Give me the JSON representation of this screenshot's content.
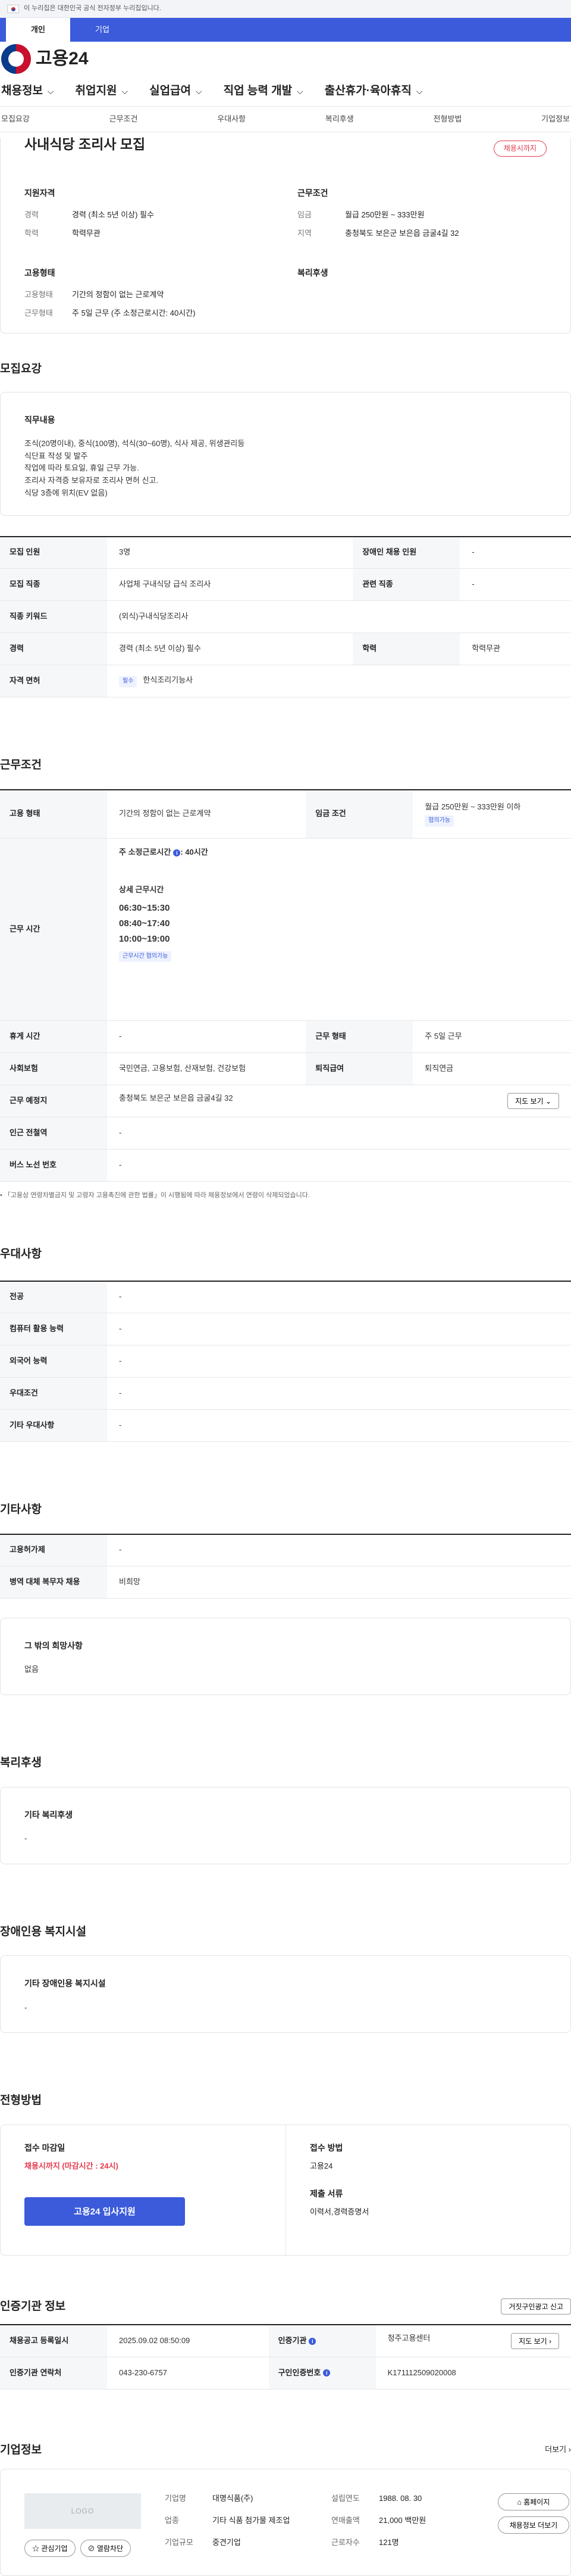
{
  "gov_banner": "이 누리집은 대한민국 공식 전자정부 누리집입니다.",
  "user_tabs": [
    "개인",
    "기업"
  ],
  "logo_text": "고용24",
  "gnb": [
    "채용정보",
    "취업지원",
    "실업급여",
    "직업 능력 개발",
    "출산휴가·육아휴직"
  ],
  "tabbar": [
    "모집요강",
    "근무조건",
    "우대사항",
    "복리후생",
    "전형방법",
    "기업정보"
  ],
  "summary": {
    "title": "사내식당 조리사 모집",
    "badge": "채용시까지",
    "blocks": [
      {
        "h": "지원자격",
        "rows": [
          [
            "경력",
            "경력 (최소 5년 이상) 필수"
          ],
          [
            "학력",
            "학력무관"
          ]
        ]
      },
      {
        "h": "근무조건",
        "rows": [
          [
            "임금",
            "월급 250만원 ~ 333만원"
          ],
          [
            "지역",
            "충청북도 보은군 보은읍 금굴4길 32"
          ]
        ]
      },
      {
        "h": "고용형태",
        "rows": [
          [
            "고용형태",
            "기간의 정함이 없는 근로계약"
          ],
          [
            "근무형태",
            "주 5일 근무 (주 소정근로시간: 40시간)"
          ]
        ]
      },
      {
        "h": "복리후생",
        "rows": []
      }
    ]
  },
  "recruit": {
    "title": "모집요강",
    "duty_h": "직무내용",
    "duty": "조식(20명이내), 중식(100명), 석식(30~60명),  식사 제공, 위생관리등\n식단표 작성 및 발주\n작업에 따라 토요일, 휴일 근무 가능.\n조리사 자격증 보유자로 조리사 면허 신고.\n식당 3층에 위치(EV 없음)",
    "t": {
      "r1k1": "모집 인원",
      "r1v1": "3명",
      "r1k2": "장애인 채용 인원",
      "r1v2": "-",
      "r2k1": "모집 직종",
      "r2v1": "사업체 구내식당 급식 조리사",
      "r2k2": "관련 직종",
      "r2v2": "-",
      "r3k": "직종 키워드",
      "r3v": "(외식)구내식당조리사",
      "r4k1": "경력",
      "r4v1": "경력 (최소 5년 이상) 필수",
      "r4k2": "학력",
      "r4v2": "학력무관",
      "r5k": "자격 면허",
      "r5chip": "필수",
      "r5v": "한식조리기능사"
    }
  },
  "work": {
    "title": "근무조건",
    "t": {
      "emp_k": "고용 형태",
      "emp_v": "기간의 정함이 없는 근로계약",
      "wage_k": "임금 조건",
      "wage_v": "월급 250만원 ~ 333만원 이하",
      "wage_chip": "협의가능",
      "time_k": "근무 시간",
      "time_h": "주 소정근로시간",
      "time_h2": ": 40시간",
      "detail_h": "상세 근무시간",
      "slots": [
        "06:30~15:30",
        "08:40~17:40",
        "10:00~19:00"
      ],
      "time_chip": "근무시간 협의가능",
      "rest_k": "휴게 시간",
      "rest_v": "-",
      "form_k": "근무 형태",
      "form_v": "주 5일 근무",
      "ins_k": "사회보험",
      "ins_v": "국민연금, 고용보험, 산재보험, 건강보험",
      "ret_k": "퇴직급여",
      "ret_v": "퇴직연금",
      "loc_k": "근무 예정지",
      "loc_v": "충청북도 보은군 보은읍 금굴4길 32",
      "map_btn": "지도 보기 ⌄",
      "sub_k": "인근 전철역",
      "sub_v": "-",
      "bus_k": "버스 노선 번호",
      "bus_v": "-"
    },
    "note": "• 「고용상 연령차별금지 및 고령자 고용촉진에 관한 법률」이 시행됨에 따라 채용정보에서 연령이 삭제되었습니다."
  },
  "pref": {
    "title": "우대사항",
    "rows": [
      [
        "전공",
        "-"
      ],
      [
        "컴퓨터 활용 능력",
        "-"
      ],
      [
        "외국어 능력",
        "-"
      ],
      [
        "우대조건",
        "-"
      ],
      [
        "기타 우대사항",
        "-"
      ]
    ]
  },
  "etc": {
    "title": "기타사항",
    "rows": [
      [
        "고용허가제",
        "-"
      ],
      [
        "병역 대체 복무자 채용",
        "비희망"
      ]
    ],
    "box_h": "그 밖의 희망사항",
    "box_v": "없음"
  },
  "welfare": {
    "title": "복리후생",
    "box_h": "기타 복리후생",
    "box_v": "-"
  },
  "disabled": {
    "title": "장애인용 복지시설",
    "box_h": "기타 장애인용 복지시설",
    "box_v": "-"
  },
  "screening": {
    "title": "전형방법",
    "deadline_h": "접수 마감일",
    "deadline_v": "채용시까지 (마감시간 : 24시)",
    "apply_btn": "고용24 입사지원",
    "method_h": "접수 방법",
    "method_v": "고용24",
    "docs_h": "제출 서류",
    "docs_v": "이력서,경력증명서"
  },
  "agency": {
    "title": "인증기관 정보",
    "report_btn": "거짓구인광고 신고",
    "reg_k": "채용공고 등록일시",
    "reg_v": "2025.09.02 08:50:09",
    "org_k": "인증기관",
    "org_v": "청주고용센터",
    "map_btn": "지도 보기 ›",
    "tel_k": "인증기관 연락처",
    "tel_v": "043-230-6757",
    "num_k": "구인인증번호",
    "num_v": "K171112509020008"
  },
  "company": {
    "title": "기업정보",
    "more": "더보기 ›",
    "logo": "LOGO",
    "fav": "☆ 관심기업",
    "block": "⊘ 열람차단",
    "name_k": "기업명",
    "name_v": "대명식품(주)",
    "ind_k": "업종",
    "ind_v": "기타 식품 첨가물 제조업",
    "size_k": "기업규모",
    "size_v": "중견기업",
    "est_k": "설립연도",
    "est_v": "1988. 08. 30",
    "sales_k": "연매출액",
    "sales_v": "21,000 백만원",
    "emp_k": "근로자수",
    "emp_v": "121명",
    "home_btn": "⌂ 홈페이지",
    "list_btn": "채용정보 더보기"
  },
  "colors": {
    "primary": "#3b5bdb",
    "alert": "#e5394c"
  }
}
